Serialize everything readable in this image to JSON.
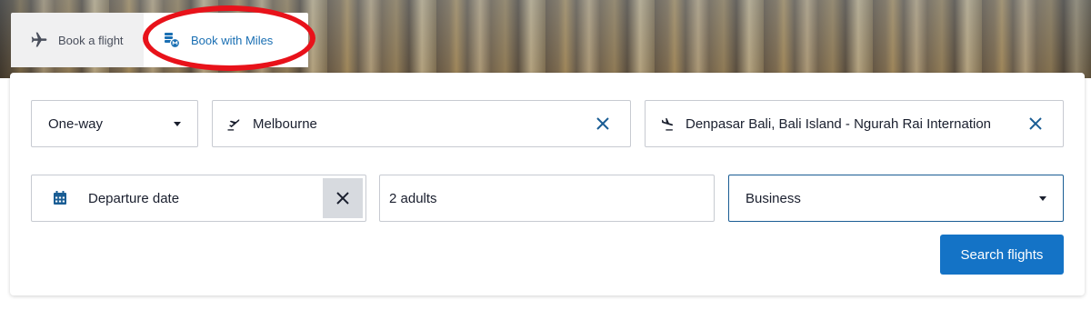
{
  "tabs": [
    {
      "label": "Book a flight",
      "icon": "airplane-icon",
      "active": false
    },
    {
      "label": "Book with Miles",
      "icon": "miles-coins-icon",
      "active": true
    }
  ],
  "form": {
    "trip_type": {
      "value": "One-way",
      "icon": "caret-down-icon"
    },
    "origin": {
      "value": "Melbourne",
      "icon": "takeoff-icon"
    },
    "destination": {
      "value": "Denpasar Bali, Bali Island - Ngurah Rai Internation",
      "icon": "landing-icon"
    },
    "departure_date": {
      "placeholder": "Departure date",
      "icon": "calendar-icon"
    },
    "passengers": {
      "value": "2 adults"
    },
    "cabin_class": {
      "value": "Business",
      "icon": "caret-down-icon"
    },
    "search_button_label": "Search flights"
  },
  "colors": {
    "accent": "#1473c6",
    "icon_blue": "#1a5d94",
    "annotation_red": "#e8121a",
    "tab_inactive_bg": "#f0f0f1"
  }
}
